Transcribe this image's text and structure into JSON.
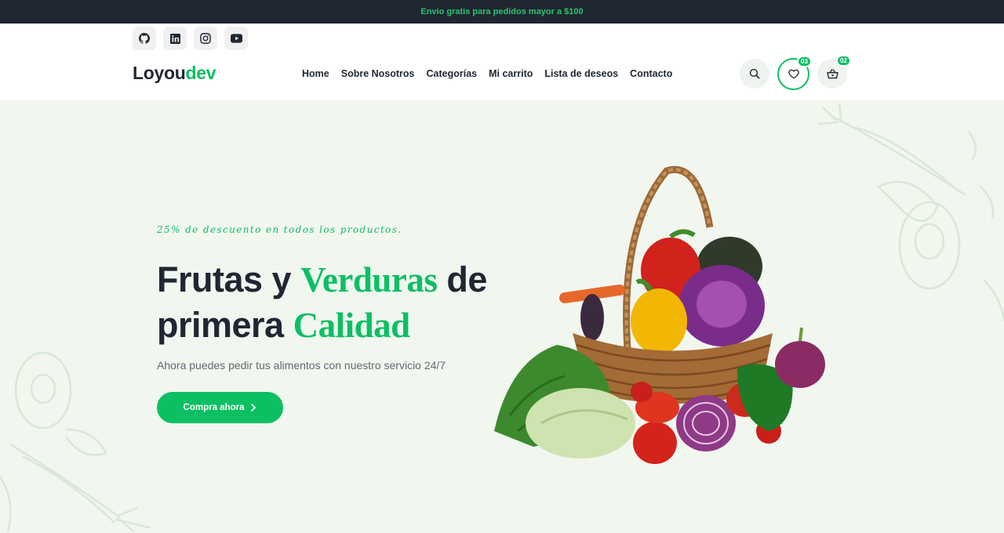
{
  "topbar": {
    "text": "Envio gratis para pedidos mayor a $100"
  },
  "socials": [
    {
      "icon": "github-icon"
    },
    {
      "icon": "linkedin-icon"
    },
    {
      "icon": "instagram-icon"
    },
    {
      "icon": "youtube-icon"
    }
  ],
  "logo": {
    "part1": "Loyou",
    "part2": "dev"
  },
  "nav": {
    "items": [
      "Home",
      "Sobre Nosotros",
      "Categorías",
      "Mi carrito",
      "Lista de deseos",
      "Contacto"
    ]
  },
  "actions": {
    "wishlist_count": "03",
    "cart_count": "02"
  },
  "hero": {
    "promo": "25% de descuento en todos los productos.",
    "line1_a": "Frutas y ",
    "line1_b": "Verduras",
    "line1_c": " de",
    "line2_a": "primera ",
    "line2_b": "Calidad",
    "subtitle": "Ahora puedes pedir tus alimentos con nuestro servicio 24/7",
    "cta": "Compra ahora"
  },
  "colors": {
    "accent": "#0cbf63",
    "dark": "#1e2732",
    "hero_bg": "#f1f6ef"
  }
}
